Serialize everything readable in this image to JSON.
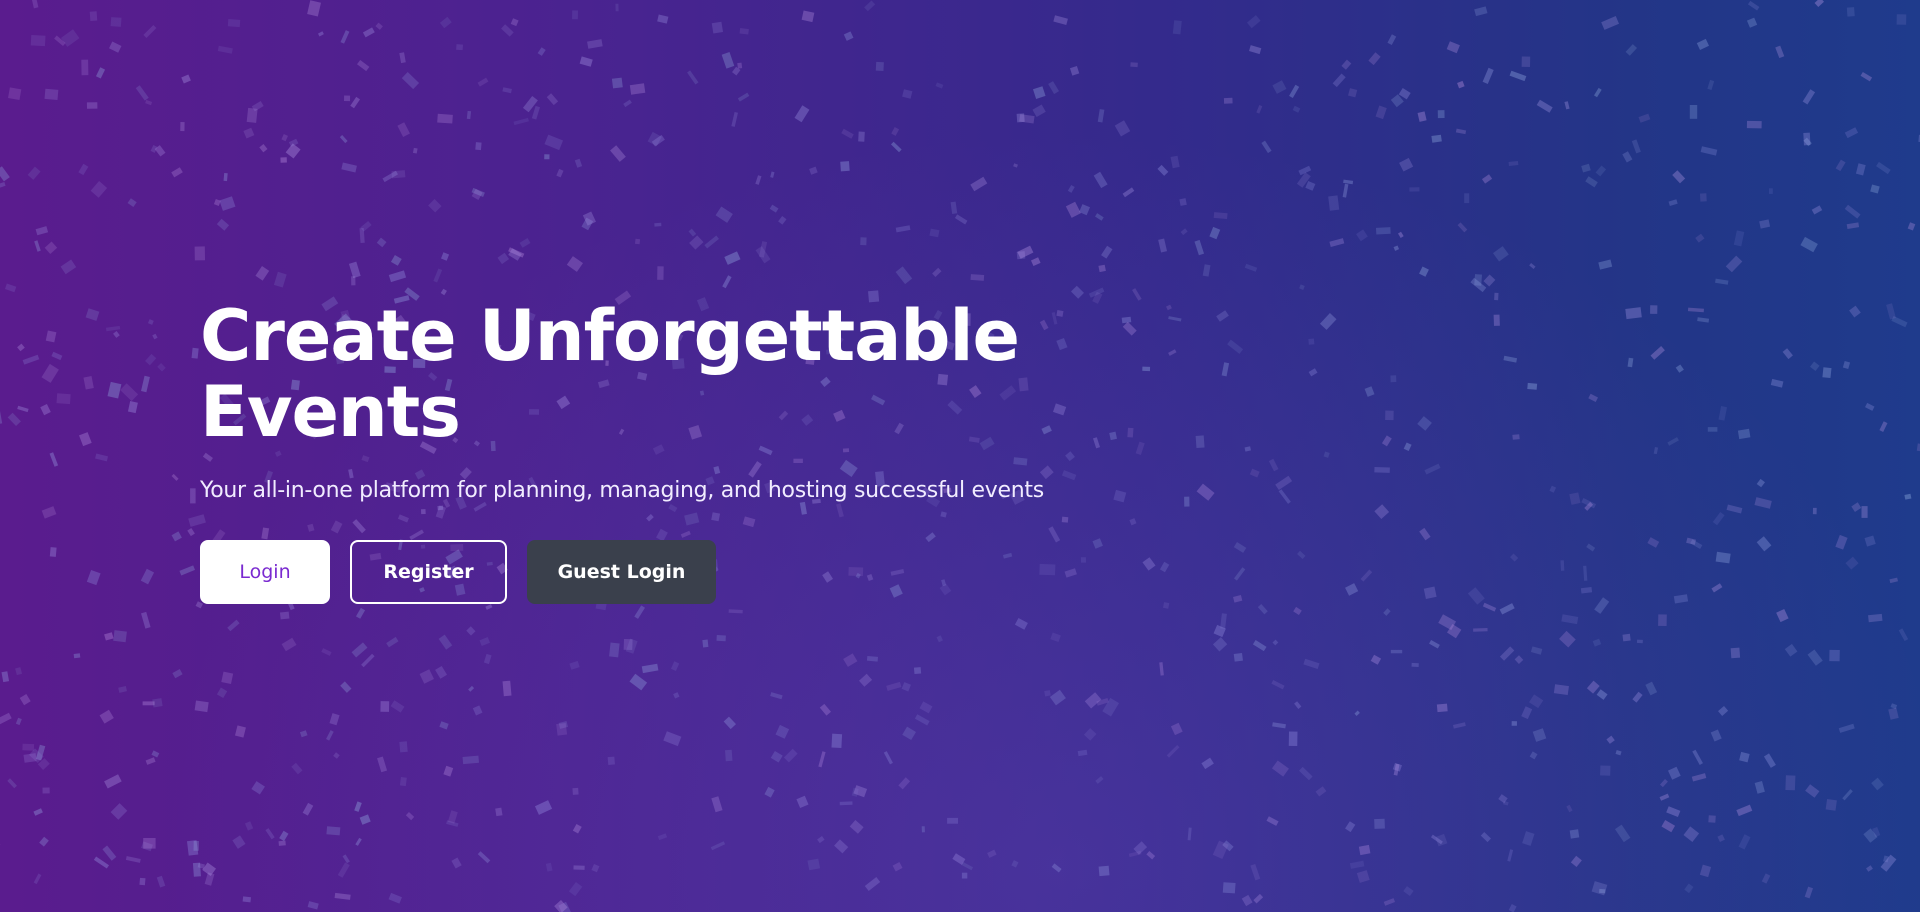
{
  "hero": {
    "title_line1": "Create Unforgettable",
    "title_line2": "Events",
    "subtitle": "Your all-in-one platform for planning, managing, and hosting successful events",
    "background_image": "confetti-background"
  },
  "actions": {
    "login_label": "Login",
    "register_label": "Register",
    "guest_login_label": "Guest Login"
  },
  "colors": {
    "gradient_left": "#5a1c8e",
    "gradient_right": "#1f3b8c",
    "login_text": "#7a2ad0",
    "guest_button": "#3a404c"
  }
}
